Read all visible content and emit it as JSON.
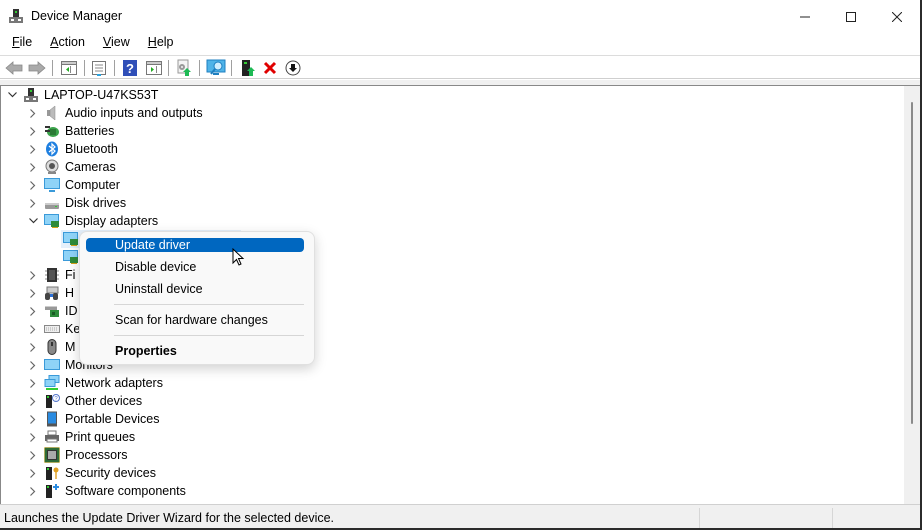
{
  "window": {
    "title": "Device Manager",
    "controls": {
      "minimize": "minimize",
      "maximize": "maximize",
      "close": "close"
    }
  },
  "menu": [
    {
      "accel": "F",
      "rest": "ile"
    },
    {
      "accel": "A",
      "rest": "ction"
    },
    {
      "accel": "V",
      "rest": "iew"
    },
    {
      "accel": "H",
      "rest": "elp"
    }
  ],
  "toolbar": {
    "buttons": [
      "back-icon",
      "forward-icon",
      "show-hide-console-tree-icon",
      "properties-icon",
      "help-icon",
      "show-action-pane-icon",
      "update-driver-icon",
      "scan-hardware-icon",
      "add-legacy-hardware-icon",
      "uninstall-icon",
      "disable-icon"
    ]
  },
  "tree": {
    "root": "LAPTOP-U47KS53T",
    "categories": [
      {
        "label": "Audio inputs and outputs",
        "icon": "speaker-icon",
        "expanded": false
      },
      {
        "label": "Batteries",
        "icon": "battery-icon",
        "expanded": false
      },
      {
        "label": "Bluetooth",
        "icon": "bluetooth-icon",
        "expanded": false
      },
      {
        "label": "Cameras",
        "icon": "camera-icon",
        "expanded": false
      },
      {
        "label": "Computer",
        "icon": "computer-icon",
        "expanded": false
      },
      {
        "label": "Disk drives",
        "icon": "disk-drive-icon",
        "expanded": false
      },
      {
        "label": "Display adapters",
        "icon": "display-adapter-icon",
        "expanded": true
      },
      {
        "label": "Fi",
        "icon": "firmware-icon",
        "expanded": false
      },
      {
        "label": "H",
        "icon": "hid-icon",
        "expanded": false
      },
      {
        "label": "ID",
        "icon": "ide-controller-icon",
        "expanded": false
      },
      {
        "label": "Ke",
        "icon": "keyboard-icon",
        "expanded": false
      },
      {
        "label": "M",
        "icon": "mouse-icon",
        "expanded": false
      },
      {
        "label": "Monitors",
        "icon": "monitor-icon",
        "expanded": false
      },
      {
        "label": "Network adapters",
        "icon": "network-adapter-icon",
        "expanded": false
      },
      {
        "label": "Other devices",
        "icon": "other-devices-icon",
        "expanded": false
      },
      {
        "label": "Portable Devices",
        "icon": "portable-device-icon",
        "expanded": false
      },
      {
        "label": "Print queues",
        "icon": "printer-icon",
        "expanded": false
      },
      {
        "label": "Processors",
        "icon": "processor-icon",
        "expanded": false
      },
      {
        "label": "Security devices",
        "icon": "security-device-icon",
        "expanded": false
      },
      {
        "label": "Software components",
        "icon": "software-component-icon",
        "expanded": false
      }
    ]
  },
  "context_menu": {
    "items": [
      {
        "label": "Update driver",
        "active": true
      },
      {
        "label": "Disable device"
      },
      {
        "label": "Uninstall device"
      },
      {
        "label": "Scan for hardware changes"
      },
      {
        "label": "Properties",
        "bold": true
      }
    ]
  },
  "statusbar": {
    "text": "Launches the Update Driver Wizard for the selected device."
  },
  "colors": {
    "menu_highlight": "#0067c0",
    "selection_bg": "#e5f0fb",
    "delete_red": "#e00000",
    "green_arrow": "#1db954"
  }
}
